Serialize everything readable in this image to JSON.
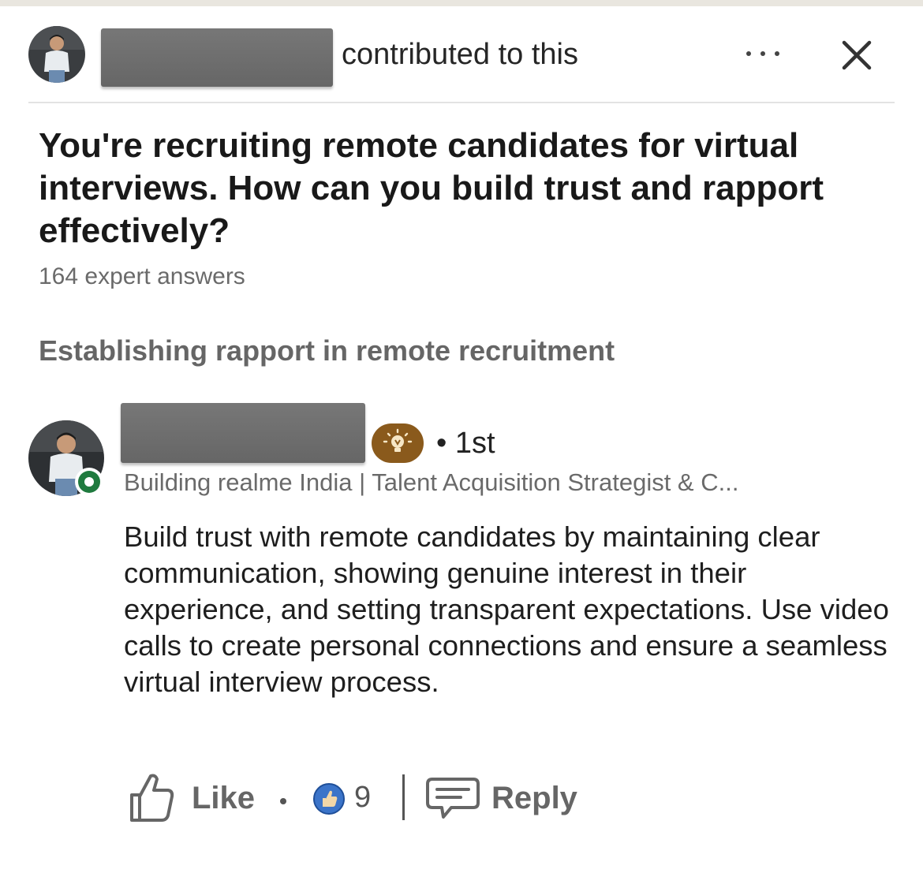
{
  "header": {
    "contributed_text": "contributed to this",
    "more_icon": "ellipsis-icon",
    "close_icon": "close-icon"
  },
  "article": {
    "title": "You're recruiting remote candidates for virtual interviews. How can you build trust and rapport effectively?",
    "answers_count": "164 expert answers",
    "section_title": "Establishing rapport in remote recruitment"
  },
  "comment": {
    "badge_icon": "lightbulb-icon",
    "connection_degree": "• 1st",
    "headline": "Building realme India | Talent Acquisition Strategist & C...",
    "body": "Build trust with remote candidates by maintaining clear communication, showing genuine interest in their experience, and setting transparent expectations. Use video calls to create personal connections and ensure a seamless virtual interview process.",
    "online_status": "online-status-icon"
  },
  "actions": {
    "like_label": "Like",
    "reaction_count": "9",
    "reply_label": "Reply"
  },
  "colors": {
    "badge": "#8a5a1c",
    "online": "#1f7a3e",
    "reaction_blue": "#3b74c9"
  }
}
